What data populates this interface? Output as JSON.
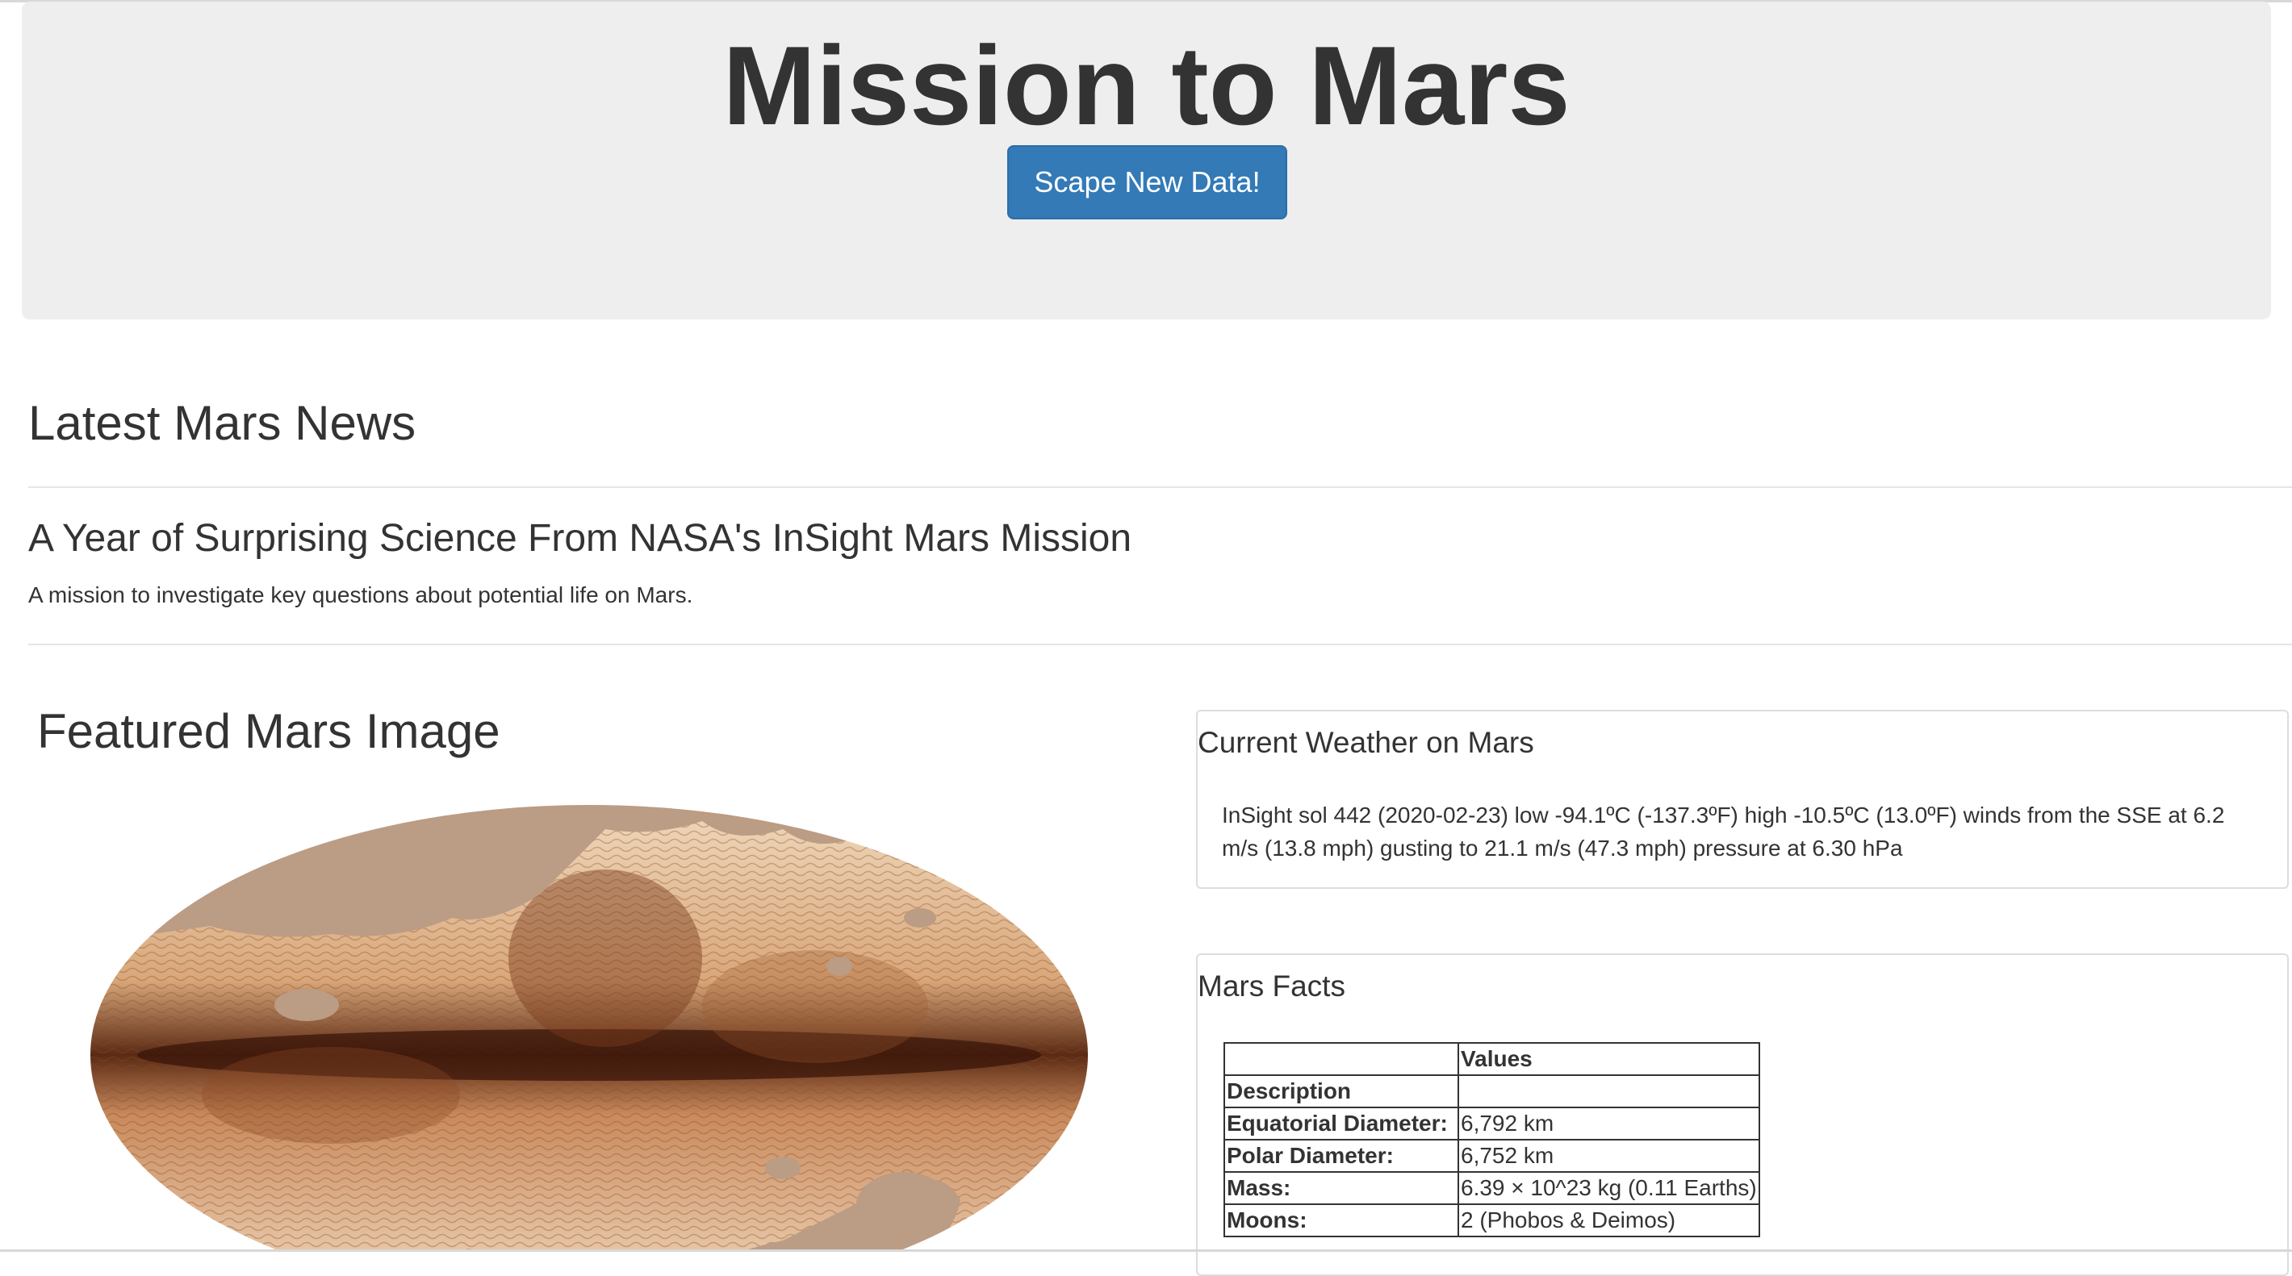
{
  "header": {
    "title": "Mission to Mars",
    "scrape_button": "Scape New Data!"
  },
  "news": {
    "heading": "Latest Mars News",
    "title": "A Year of Surprising Science From NASA's InSight Mars Mission",
    "teaser": "A mission to investigate key questions about potential life on Mars."
  },
  "featured_image": {
    "heading": "Featured Mars Image",
    "icon": "mars-sky-map-image"
  },
  "weather": {
    "heading": "Current Weather on Mars",
    "text": "InSight sol 442 (2020-02-23) low -94.1ºC (-137.3ºF) high -10.5ºC (13.0ºF) winds from the SSE at 6.2 m/s (13.8 mph) gusting to 21.1 m/s (47.3 mph) pressure at 6.30 hPa"
  },
  "facts": {
    "heading": "Mars Facts",
    "column_header": "Values",
    "index_header": "Description",
    "rows": [
      {
        "label": "Equatorial Diameter:",
        "value": "6,792 km"
      },
      {
        "label": "Polar Diameter:",
        "value": "6,752 km"
      },
      {
        "label": "Mass:",
        "value": "6.39 × 10^23 kg (0.11 Earths)"
      },
      {
        "label": "Moons:",
        "value": "2 (Phobos & Deimos)"
      }
    ]
  },
  "colors": {
    "button": "#337ab7",
    "jumbotron": "#eeeeee",
    "text": "#333333"
  }
}
